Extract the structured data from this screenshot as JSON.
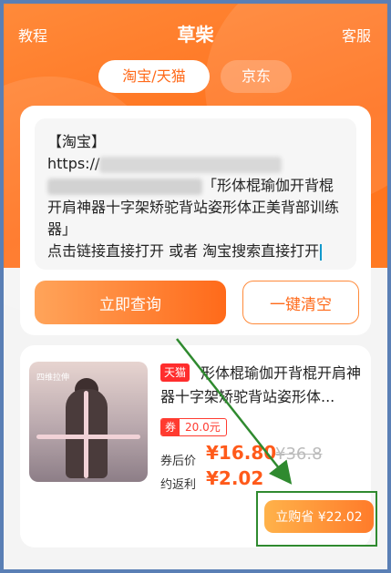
{
  "header": {
    "left_label": "教程",
    "title": "草柴",
    "right_label": "客服"
  },
  "tabs": [
    {
      "label": "淘宝/天猫",
      "active": true
    },
    {
      "label": "京东",
      "active": false
    }
  ],
  "input": {
    "line1": "【淘宝】",
    "url_prefix": "https://",
    "product_quote": "「形体棍瑜伽开背棍开肩神器十字架矫驼背站姿形体正美背部训练器」",
    "hint": "点击链接直接打开 或者 淘宝搜索直接打开"
  },
  "actions": {
    "query_label": "立即查询",
    "clear_label": "一键清空"
  },
  "product": {
    "platform_badge": "天猫",
    "title": "形体棍瑜伽开背棍开肩神器十字架矫驼背站姿形体...",
    "thumbnail_caption": "四维拉伸",
    "coupon_tag": "券",
    "coupon_value": "20.0元",
    "price_label": "券后价",
    "price": "¥16.80",
    "original_price": "¥36.8",
    "rebate_label": "约返利",
    "rebate": "¥2.02",
    "buy_label": "立购省 ¥22.02"
  },
  "colors": {
    "brand_orange": "#ff6a1a",
    "highlight_green": "#2f8a2f",
    "tmall_red": "#ff2d2d"
  }
}
